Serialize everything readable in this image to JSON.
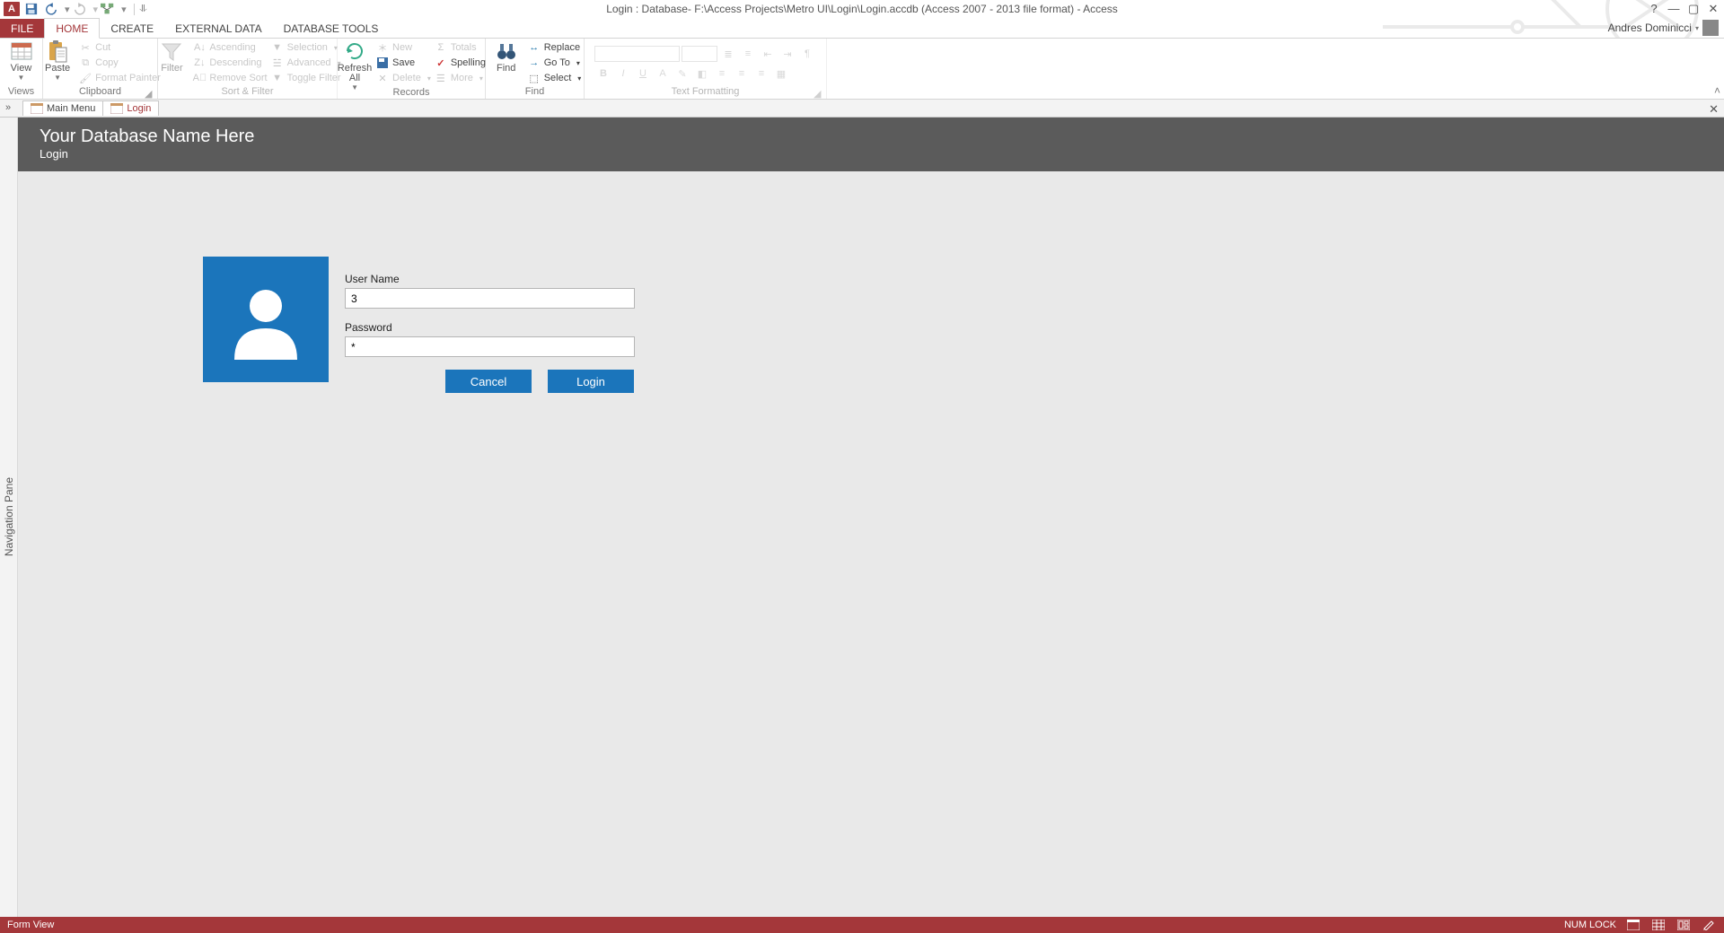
{
  "app": {
    "title": "Login : Database- F:\\Access Projects\\Metro UI\\Login\\Login.accdb (Access 2007 - 2013 file format) - Access",
    "help_tip": "?"
  },
  "account": {
    "name": "Andres Dominicci"
  },
  "tabs": {
    "file": "FILE",
    "home": "HOME",
    "create": "CREATE",
    "external": "EXTERNAL DATA",
    "dbtools": "DATABASE TOOLS"
  },
  "ribbon": {
    "views": {
      "label": "Views",
      "view": "View"
    },
    "clipboard": {
      "label": "Clipboard",
      "paste": "Paste",
      "cut": "Cut",
      "copy": "Copy",
      "painter": "Format Painter"
    },
    "sort": {
      "label": "Sort & Filter",
      "filter": "Filter",
      "asc": "Ascending",
      "desc": "Descending",
      "remove": "Remove Sort",
      "selection": "Selection",
      "advanced": "Advanced",
      "toggle": "Toggle Filter"
    },
    "records": {
      "label": "Records",
      "refresh": "Refresh",
      "refresh2": "All",
      "new": "New",
      "save": "Save",
      "delete": "Delete",
      "totals": "Totals",
      "spelling": "Spelling",
      "more": "More"
    },
    "find": {
      "label": "Find",
      "find": "Find",
      "replace": "Replace",
      "goto": "Go To",
      "select": "Select"
    },
    "textfmt": {
      "label": "Text Formatting"
    }
  },
  "doctabs": {
    "mainmenu": "Main Menu",
    "login": "Login"
  },
  "nav": {
    "pane": "Navigation Pane"
  },
  "form": {
    "title": "Your Database Name Here",
    "subtitle": "Login",
    "user_label": "User Name",
    "user_value": "3",
    "pwd_label": "Password",
    "pwd_value": "*",
    "cancel": "Cancel",
    "login": "Login"
  },
  "status": {
    "left": "Form View",
    "numlock": "NUM LOCK"
  }
}
